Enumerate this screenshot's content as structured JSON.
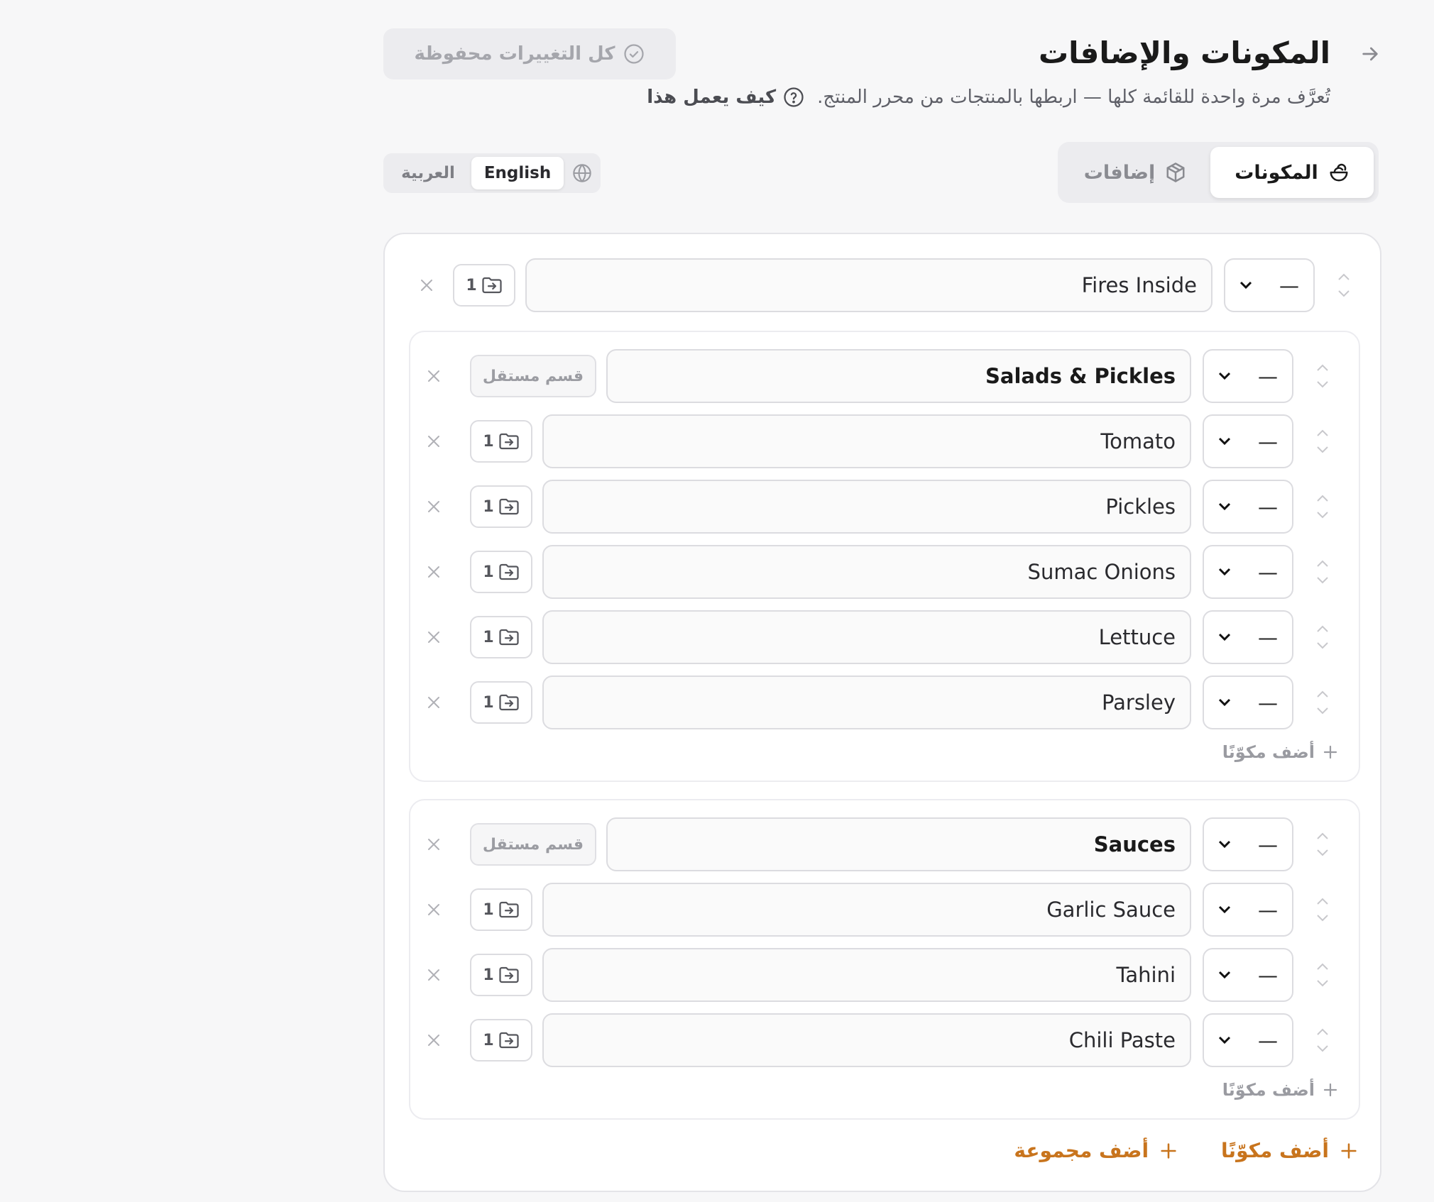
{
  "header": {
    "title": "المكونات والإضافات",
    "subtitle": "تُعرَّف مرة واحدة للقائمة كلها — اربطها بالمنتجات من محرر المنتج.",
    "help_label": "كيف يعمل هذا",
    "saved_status": "كل التغييرات محفوظة"
  },
  "tabs": [
    {
      "label": "المكونات",
      "active": true
    },
    {
      "label": "إضافات",
      "active": false
    }
  ],
  "languages": [
    {
      "label": "English",
      "active": true
    },
    {
      "label": "العربية",
      "active": false
    }
  ],
  "top_item": {
    "name": "Fires Inside",
    "qty": "—",
    "links": "1"
  },
  "groups": [
    {
      "name": "Salads & Pickles",
      "qty": "—",
      "independent_label": "قسم مستقل",
      "items": [
        {
          "name": "Tomato",
          "qty": "—",
          "links": "1"
        },
        {
          "name": "Pickles",
          "qty": "—",
          "links": "1"
        },
        {
          "name": "Sumac Onions",
          "qty": "—",
          "links": "1"
        },
        {
          "name": "Lettuce",
          "qty": "—",
          "links": "1"
        },
        {
          "name": "Parsley",
          "qty": "—",
          "links": "1"
        }
      ],
      "add_label": "أضف مكوّنًا"
    },
    {
      "name": "Sauces",
      "qty": "—",
      "independent_label": "قسم مستقل",
      "items": [
        {
          "name": "Garlic Sauce",
          "qty": "—",
          "links": "1"
        },
        {
          "name": "Tahini",
          "qty": "—",
          "links": "1"
        },
        {
          "name": "Chili Paste",
          "qty": "—",
          "links": "1"
        }
      ],
      "add_label": "أضف مكوّنًا"
    }
  ],
  "footer": {
    "add_item_label": "أضف مكوّنًا",
    "add_group_label": "أضف مجموعة"
  },
  "colors": {
    "accent": "#c8741d"
  }
}
